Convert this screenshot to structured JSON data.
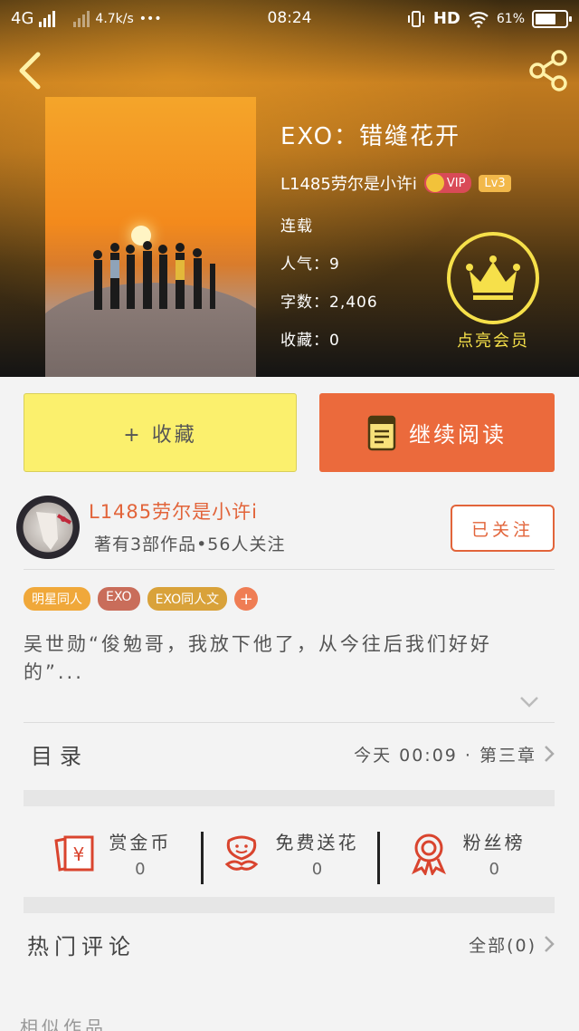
{
  "status_bar": {
    "network": "4G",
    "speed": "4.7k/s",
    "more": "•••",
    "time": "08:24",
    "hd": "HD",
    "battery": "61%"
  },
  "book": {
    "title": "EXO：错缝花开",
    "author": "L1485劳尔是小许i",
    "vip": "VIP",
    "level": "Lv3",
    "status": "连载",
    "popularity": "人气：9",
    "word_count": "字数：2,406",
    "favorites": "收藏：0",
    "member_label": "点亮会员"
  },
  "actions": {
    "favorite_label": "+ 收藏",
    "read_label": "继续阅读"
  },
  "author_card": {
    "name": "L1485劳尔是小许i",
    "meta": "著有3部作品•56人关注",
    "follow_label": "已关注"
  },
  "tags": [
    {
      "label": "明星同人",
      "color": "#f0a83a"
    },
    {
      "label": "EXO",
      "color": "#c96d5a"
    },
    {
      "label": "EXO同人文",
      "color": "#d9a23a"
    }
  ],
  "tag_add": "+",
  "synopsis": "吴世勋“俊勉哥，我放下他了，从今往后我们好好的”...",
  "toc": {
    "label": "目录",
    "latest": "今天 00:09 · 第三章"
  },
  "stats": [
    {
      "label": "赏金币",
      "value": "0",
      "icon": "coin-icon"
    },
    {
      "label": "免费送花",
      "value": "0",
      "icon": "flower-icon"
    },
    {
      "label": "粉丝榜",
      "value": "0",
      "icon": "medal-icon"
    }
  ],
  "comments": {
    "title": "热门评论",
    "all": "全部(0)"
  },
  "similar_title": "相似作品",
  "colors": {
    "accent": "#eb6a3c",
    "favorite_bg": "#fbf06d",
    "member_gold": "#f6e04a"
  }
}
